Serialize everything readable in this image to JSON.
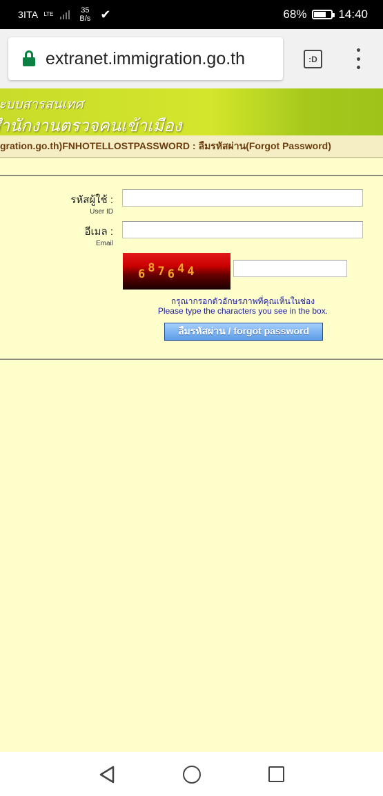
{
  "status_bar": {
    "carrier": "3ITA",
    "network": "LTE",
    "speed_value": "35",
    "speed_unit": "B/s",
    "battery_percent": "68%",
    "battery_level": 0.68,
    "time": "14:40"
  },
  "browser": {
    "url": "extranet.immigration.go.th",
    "tabs_label": ":D"
  },
  "banner": {
    "line1": "ระบบสารสนเทศ",
    "line2": "สำนักงานตรวจคนเข้าเมือง"
  },
  "page_title": "gration.go.th)FNHOTELLOSTPASSWORD : ลืมรหัสผ่าน(Forgot Password)",
  "form": {
    "user_id_label": "รหัสผู้ใช้ :",
    "user_id_sublabel": "User ID",
    "user_id_value": "",
    "email_label": "อีเมล :",
    "email_sublabel": "Email",
    "email_value": "",
    "captcha_chars": [
      "6",
      "8",
      "7",
      "6",
      "4",
      "4"
    ],
    "captcha_value": "",
    "hint_thai": "กรุณากรอกตัวอักษรภาพที่คุณเห็นในช่อง",
    "hint_english": "Please type the characters you see in the box.",
    "submit_label": "ลืมรหัสผ่าน / forgot password"
  },
  "colors": {
    "page_background": "#ffffcc",
    "title_text": "#6b3d0f",
    "hint_text": "#1a1aa8",
    "button_blue": "#7fb5f3",
    "lock_green": "#0b8043"
  }
}
